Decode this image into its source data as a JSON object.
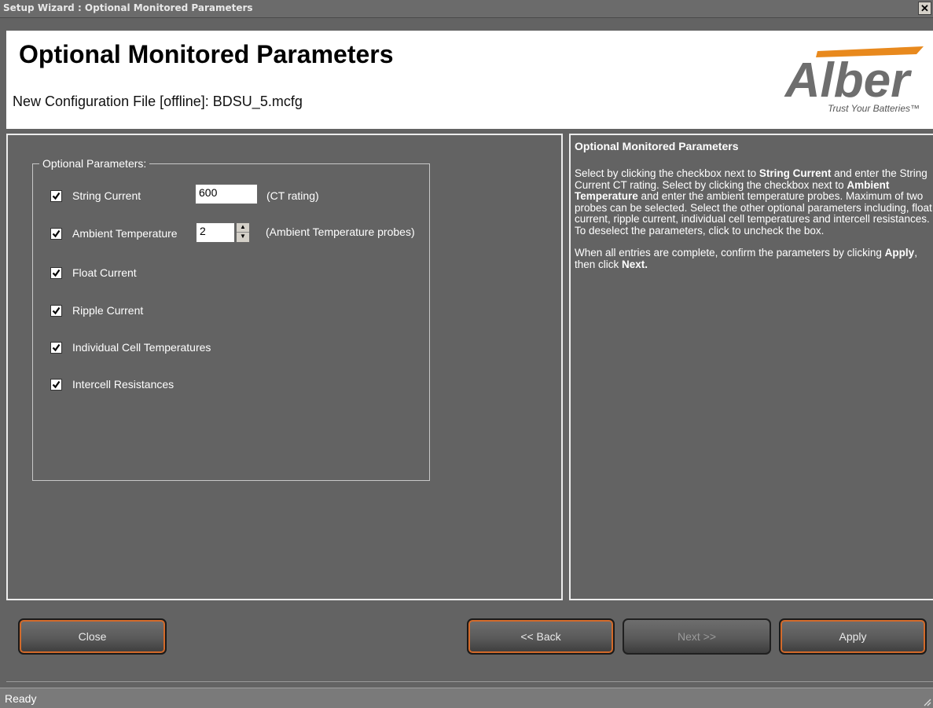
{
  "window": {
    "title": "Setup Wizard : Optional Monitored Parameters",
    "close_glyph": "✕"
  },
  "header": {
    "page_title": "Optional Monitored Parameters",
    "subtitle": "New Configuration File [offline]: BDSU_5.mcfg",
    "logo_text": "Alber",
    "logo_tagline": "Trust Your Batteries™",
    "logo_color": "#6e6e6e",
    "logo_accent": "#e8891d"
  },
  "group": {
    "legend": "Optional Parameters:",
    "items": [
      {
        "label": "String Current",
        "checked": true
      },
      {
        "label": "Ambient Temperature",
        "checked": true
      },
      {
        "label": "Float Current",
        "checked": true
      },
      {
        "label": "Ripple Current",
        "checked": true
      },
      {
        "label": "Individual Cell Temperatures",
        "checked": true
      },
      {
        "label": "Intercell Resistances",
        "checked": true
      }
    ],
    "ct_value": "600",
    "ct_unit": "(CT rating)",
    "probes_value": "2",
    "probes_unit": "(Ambient Temperature probes)"
  },
  "help": {
    "title": "Optional Monitored Parameters",
    "p1_a": "Select by clicking the checkbox next to ",
    "p1_b": "String Current",
    "p1_c": " and enter the String Current CT rating. Select by clicking the checkbox next to ",
    "p1_d": "Ambient Temperature",
    "p1_e": " and enter the ambient temperature probes. Maximum of two probes can be selected. Select the other optional parameters including, float current, ripple current, individual cell temperatures and intercell resistances. To deselect the parameters, click to uncheck the box.",
    "p2_a": "When all entries are complete, confirm the parameters by clicking ",
    "p2_b": "Apply",
    "p2_c": ", then click ",
    "p2_d": "Next."
  },
  "buttons": {
    "close": "Close",
    "back": "<< Back",
    "next": "Next >>",
    "apply": "Apply"
  },
  "status": {
    "text": "Ready"
  }
}
